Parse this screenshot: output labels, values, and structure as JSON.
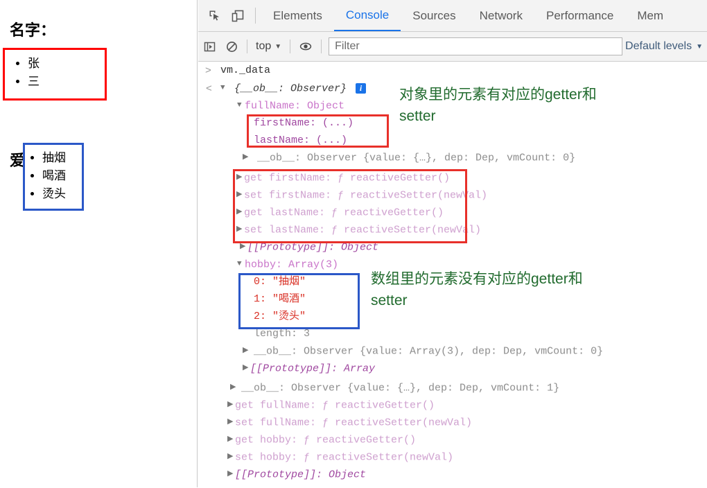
{
  "page": {
    "name_heading": "名字：",
    "name_items": [
      "张",
      "三"
    ],
    "hobby_heading": "爱好：",
    "hobby_items": [
      "抽烟",
      "喝酒",
      "烫头"
    ],
    "name_box_color": "#ff0000",
    "hobby_box_color": "#2b58c8"
  },
  "devtools": {
    "tabs": [
      {
        "label": "Elements",
        "active": false
      },
      {
        "label": "Console",
        "active": true
      },
      {
        "label": "Sources",
        "active": false
      },
      {
        "label": "Network",
        "active": false
      },
      {
        "label": "Performance",
        "active": false
      },
      {
        "label": "Mem",
        "active": false
      }
    ],
    "icons": {
      "inspect": "inspect-element-icon",
      "device": "device-toolbar-icon",
      "sidebar": "console-sidebar-icon",
      "clear": "clear-console-icon",
      "eye": "console-settings-eye-icon",
      "caret": "▼"
    },
    "filterbar": {
      "context": "top",
      "filter_placeholder": "Filter",
      "filter_value": "",
      "levels": "Default levels",
      "levels_caret": "▼"
    },
    "accent_color": "#1a73e8"
  },
  "console": {
    "prompt_symbol": ">",
    "prompt_text": "vm._data",
    "result_symbol": "<",
    "lines": {
      "root": "{__ob__: Observer}",
      "fullName": "fullName: Object",
      "firstName": "firstName: (...)",
      "lastName": "lastName: (...)",
      "ob_full": "__ob__: Observer {value: {…}, dep: Dep, vmCount: 0}",
      "get_firstName": "get firstName: ƒ reactiveGetter()",
      "set_firstName": "set firstName: ƒ reactiveSetter(newVal)",
      "get_lastName": "get lastName: ƒ reactiveGetter()",
      "set_lastName": "set lastName: ƒ reactiveSetter(newVal)",
      "proto_obj_1": "[[Prototype]]: Object",
      "hobby": "hobby: Array(3)",
      "arr0": "0: \"抽烟\"",
      "arr1": "1: \"喝酒\"",
      "arr2": "2: \"烫头\"",
      "length": "length: 3",
      "ob_arr": "__ob__: Observer {value: Array(3), dep: Dep, vmCount: 0}",
      "proto_array": "[[Prototype]]: Array",
      "ob_root": "__ob__: Observer {value: {…}, dep: Dep, vmCount: 1}",
      "get_fullName": "get fullName: ƒ reactiveGetter()",
      "set_fullName": "set fullName: ƒ reactiveSetter(newVal)",
      "get_hobby": "get hobby: ƒ reactiveGetter()",
      "set_hobby": "set hobby: ƒ reactiveSetter(newVal)",
      "proto_obj_2": "[[Prototype]]: Object"
    },
    "info_badge": "i"
  },
  "annotations": {
    "object_note": "对象里的元素有对应的getter和\nsetter",
    "array_note": "数组里的元素没有对应的getter和\nsetter",
    "note_color": "#216b2e",
    "box_red": "#e8302a",
    "box_blue": "#2b58c8"
  }
}
